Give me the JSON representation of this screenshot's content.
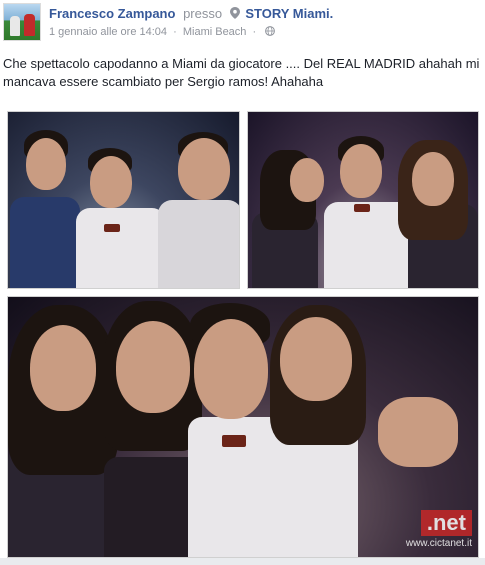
{
  "post": {
    "author": "Francesco Zampano",
    "presso": "presso",
    "place": "STORY Miami.",
    "timestamp": "1 gennaio alle ore 14:04",
    "separator": "·",
    "location": "Miami Beach",
    "text": "Che spettacolo capodanno a Miami da giocatore .... Del REAL MADRID ahahah mi mancava essere scambiato per Sergio ramos! Ahahaha"
  },
  "watermark": {
    "label": ".net",
    "url": "www.cictanet.it"
  },
  "icons": {
    "pin": "location-pin-icon",
    "globe": "globe-icon"
  },
  "colors": {
    "link": "#365899",
    "meta": "#90949c",
    "text": "#1d2129",
    "watermark": "#c62828"
  }
}
